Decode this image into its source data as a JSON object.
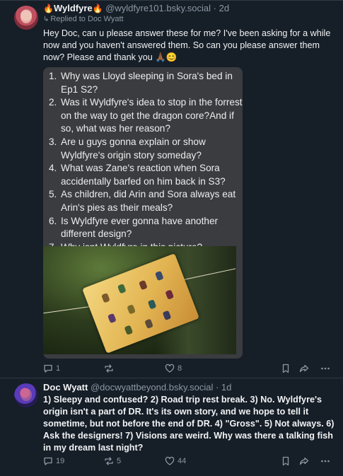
{
  "post1": {
    "author_name": "Wyldfyre",
    "author_emoji": "🔥",
    "handle": "@wyldfyre101.bsky.social",
    "separator": "·",
    "time": "2d",
    "reply_context": "Replied to Doc Wyatt",
    "text": "Hey Doc, can u please answer these for me? I've been asking for a while now and you haven't answered them. So can you please answer them now? Please and thank you 🙏🏾😊",
    "questions": [
      {
        "num": "1.",
        "text": "Why was Lloyd sleeping in Sora's bed in Ep1 S2?"
      },
      {
        "num": "2.",
        "text": "Was it Wyldfyre's idea to stop in the forrest on the way to get the dragon core?And if so, what was her reason?"
      },
      {
        "num": "3.",
        "text": "Are u guys gonna explain or show Wyldfyre's origin story someday?"
      },
      {
        "num": "4.",
        "text": "What was Zane's reaction when Sora accidentally barfed on him back in S3?"
      },
      {
        "num": "5.",
        "text": "As children, did Arin and Sora always eat Arin's pies as their meals?"
      },
      {
        "num": "6.",
        "text": "Is Wyldfyre ever gonna have another different design?"
      },
      {
        "num": "7.",
        "text": "Why isnt Wyldfyre in this picture?"
      }
    ],
    "actions": {
      "reply_count": "1",
      "repost_count": "",
      "like_count": "8"
    }
  },
  "post2": {
    "author_name": "Doc Wyatt",
    "handle": "@docwyattbeyond.bsky.social",
    "separator": "·",
    "time": "1d",
    "text": "1) Sleepy and confused? 2) Road trip rest break. 3) No. Wyldfyre's origin isn't a part of DR. It's its own story, and we hope to tell it sometime, but not before the end of DR. 4) \"Gross\". 5) Not always. 6) Ask the designers! 7) Visions are weird. Why was there a talking fish in my dream last night?",
    "actions": {
      "reply_count": "19",
      "repost_count": "5",
      "like_count": "44"
    }
  },
  "icons": {
    "reply": "comment-bubble-icon",
    "repost": "repost-arrows-icon",
    "like": "heart-icon",
    "bookmark": "bookmark-icon",
    "share": "share-arrow-icon",
    "more": "more-dots-icon"
  },
  "colors": {
    "background": "#161e27",
    "text": "#f1f3f5",
    "muted": "#8b98a5",
    "quote_bg": "#3a3c40"
  }
}
